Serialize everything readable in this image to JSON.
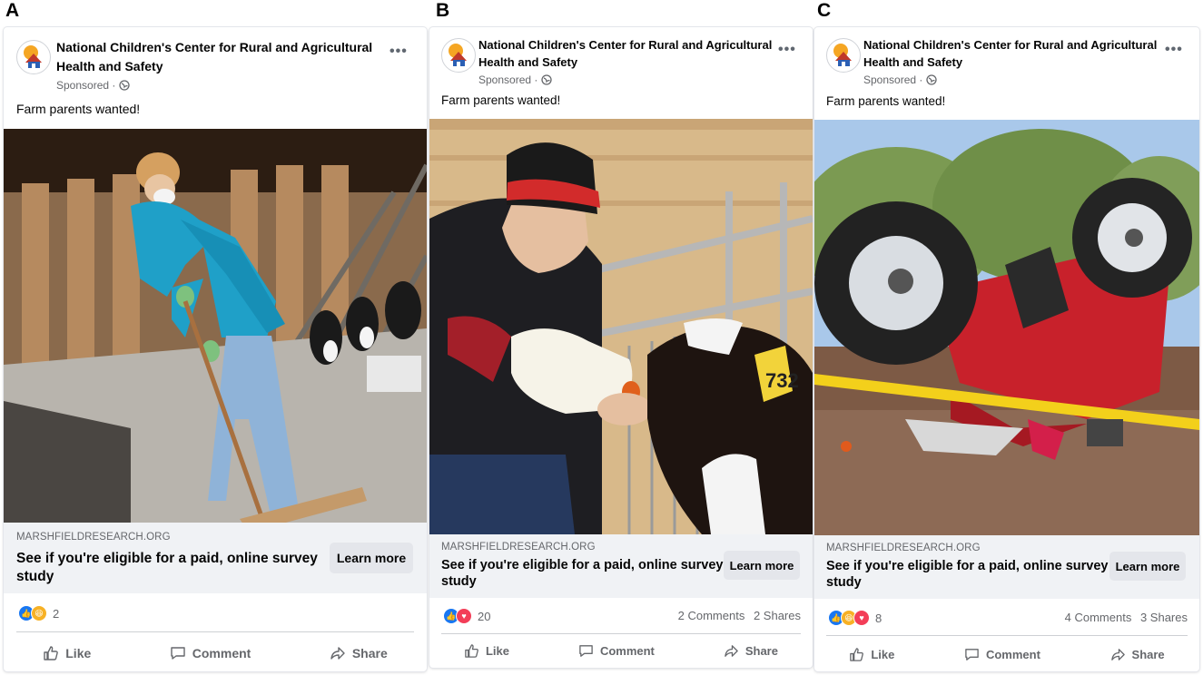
{
  "panels": [
    {
      "letter": "A",
      "page_name_line1": "National Children's Center for Rural and Agricultural",
      "page_name_line2": "Health and Safety",
      "sponsored": "Sponsored ·",
      "caption": "Farm parents wanted!",
      "domain": "MARSHFIELDRESEARCH.ORG",
      "headline_line1": "See if you're eligible for a paid, online survey",
      "headline_line2": "study",
      "cta": "Learn more",
      "reactions": [
        "like-icon",
        "haha-icon"
      ],
      "reaction_count": "2",
      "comments": "",
      "shares": ""
    },
    {
      "letter": "B",
      "page_name_line1": "National Children's Center for Rural and Agricultural",
      "page_name_line2": "Health and Safety",
      "sponsored": "Sponsored ·",
      "caption": "Farm parents wanted!",
      "domain": "MARSHFIELDRESEARCH.ORG",
      "headline_line1": "See if you're eligible for a paid, online survey",
      "headline_line2": "study",
      "cta": "Learn more",
      "reactions": [
        "like-icon",
        "love-icon"
      ],
      "reaction_count": "20",
      "comments": "2 Comments",
      "shares": "2 Shares",
      "ear_tag": "732"
    },
    {
      "letter": "C",
      "page_name_line1": "National Children's Center for Rural and Agricultural",
      "page_name_line2": "Health and Safety",
      "sponsored": "Sponsored ·",
      "caption": "Farm parents wanted!",
      "domain": "MARSHFIELDRESEARCH.ORG",
      "headline_line1": "See if you're eligible for a paid, online survey",
      "headline_line2": "study",
      "cta": "Learn more",
      "reactions": [
        "like-icon",
        "haha-icon",
        "love-icon"
      ],
      "reaction_count": "8",
      "comments": "4 Comments",
      "shares": "3 Shares"
    }
  ],
  "actions": {
    "like": "Like",
    "comment": "Comment",
    "share": "Share"
  },
  "colors": {
    "facebook_blue": "#1877f2",
    "link_box_bg": "#f0f2f5",
    "secondary_text": "#65676b"
  }
}
